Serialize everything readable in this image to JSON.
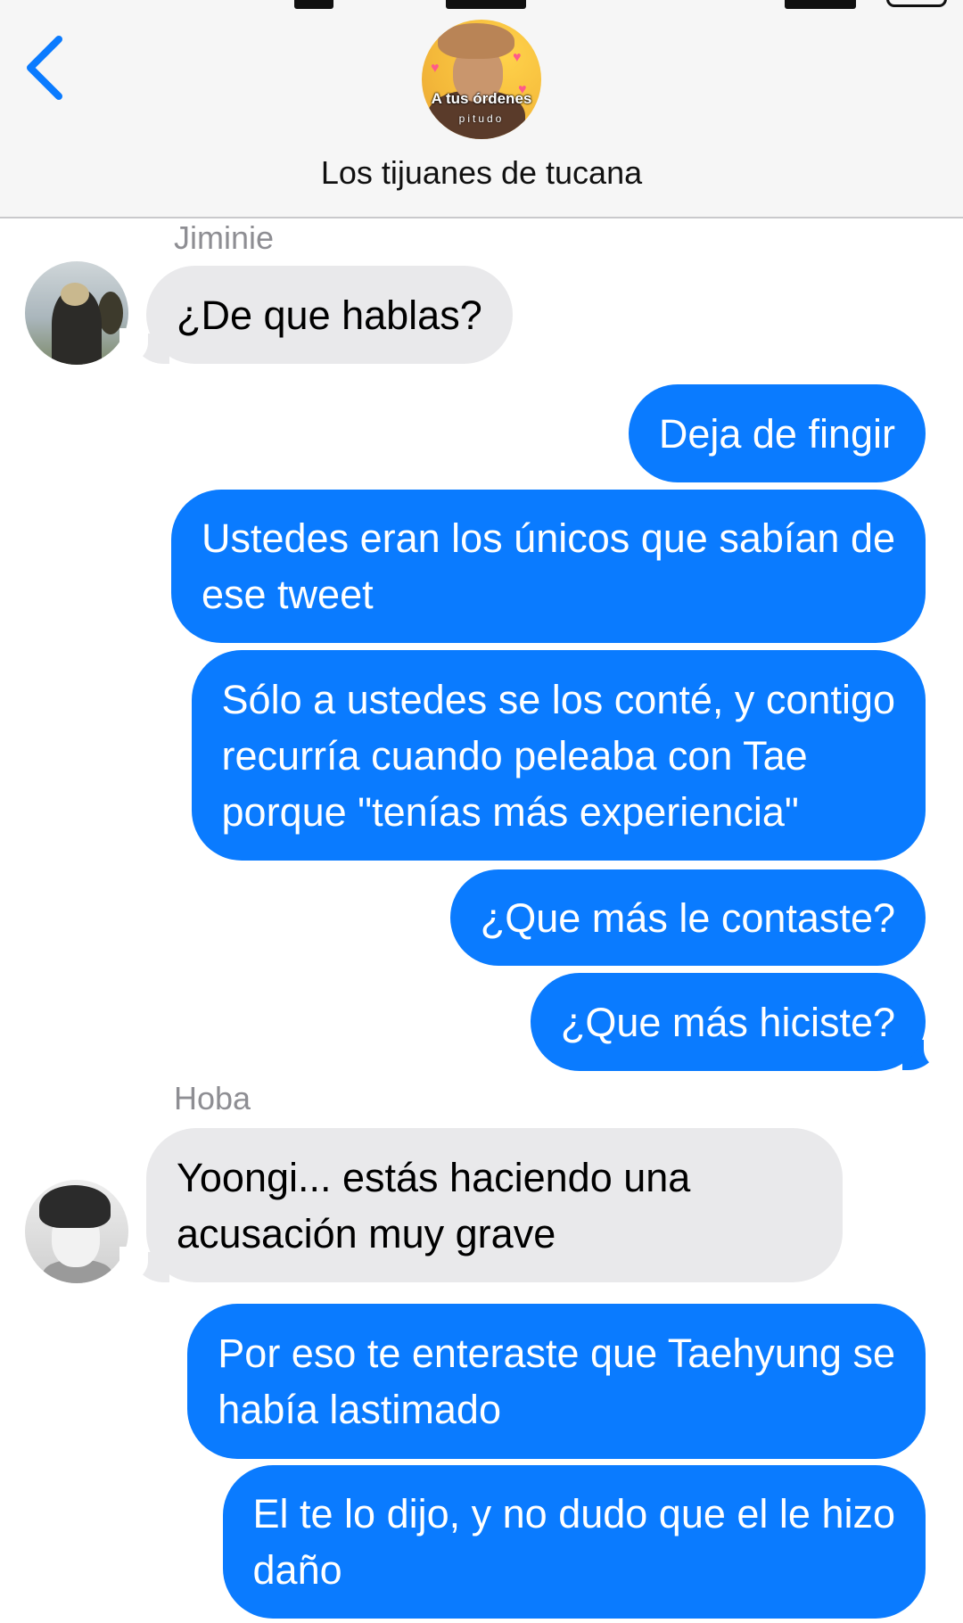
{
  "conversation": {
    "title": "Los tijuanes de tucana",
    "avatar_caption": "A tus órdenes",
    "avatar_subcaption": "pitudo",
    "back_icon": "chevron-left-icon",
    "accent_color": "#0a7bff",
    "incoming_color": "#e9e9eb"
  },
  "messages": [
    {
      "sender": "Jiminie",
      "direction": "incoming",
      "text": "¿De que hablas?"
    },
    {
      "direction": "outgoing",
      "text": "Deja de fingir"
    },
    {
      "direction": "outgoing",
      "lines": [
        "Ustedes eran los únicos que sabían de",
        "ese tweet"
      ]
    },
    {
      "direction": "outgoing",
      "lines": [
        "Sólo a ustedes se los conté, y contigo",
        "recurría cuando peleaba con Tae",
        "porque \"tenías más experiencia\""
      ]
    },
    {
      "direction": "outgoing",
      "text": "¿Que más le contaste?"
    },
    {
      "direction": "outgoing",
      "text": "¿Que más hiciste?"
    },
    {
      "sender": "Hoba",
      "direction": "incoming",
      "lines": [
        "Yoongi... estás haciendo una",
        "acusación muy grave"
      ]
    },
    {
      "direction": "outgoing",
      "lines": [
        "Por eso te enteraste que Taehyung se",
        "había lastimado"
      ]
    },
    {
      "direction": "outgoing",
      "lines": [
        "El te lo dijo, y no dudo que el le hizo",
        "daño"
      ]
    }
  ]
}
